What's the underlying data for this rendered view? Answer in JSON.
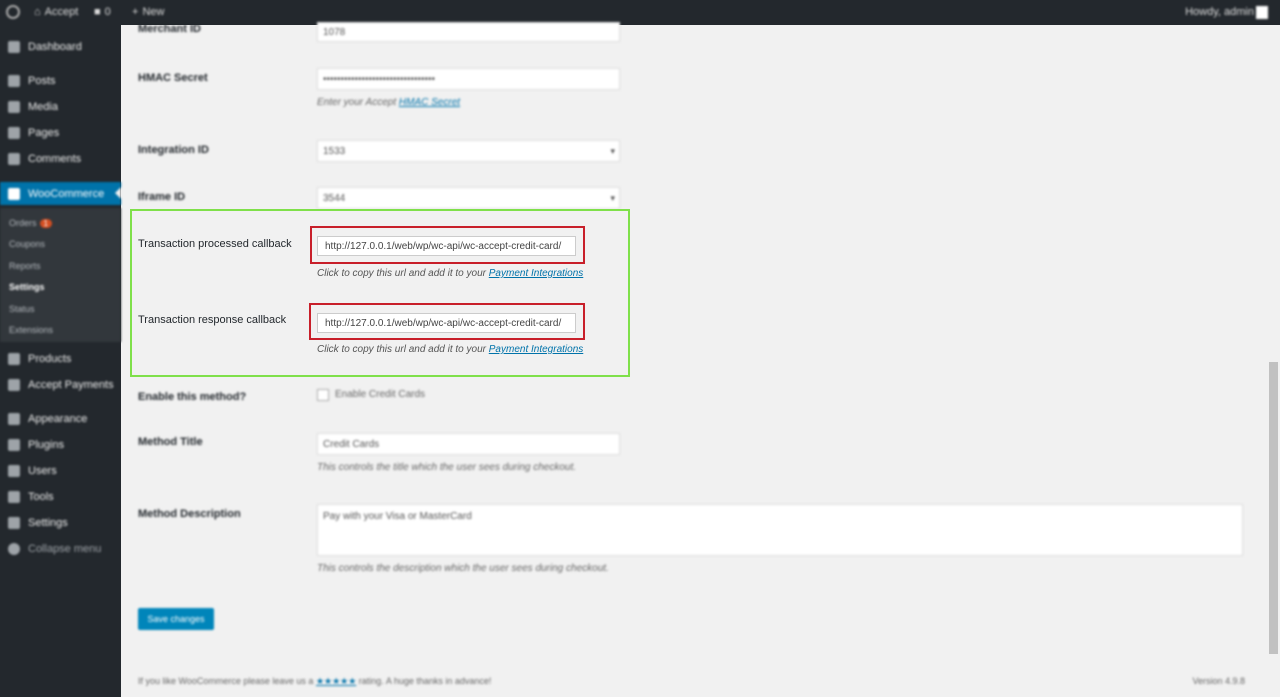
{
  "admin_bar": {
    "site_name": "Accept",
    "comments_count": "0",
    "new_label": "New",
    "howdy": "Howdy, admin"
  },
  "sidebar": {
    "items": [
      {
        "label": "Dashboard",
        "icon": "dashboard-icon"
      },
      {
        "label": "Posts",
        "icon": "pin-icon"
      },
      {
        "label": "Media",
        "icon": "media-icon"
      },
      {
        "label": "Pages",
        "icon": "pages-icon"
      },
      {
        "label": "Comments",
        "icon": "comment-icon"
      },
      {
        "label": "WooCommerce",
        "icon": "woo-icon"
      },
      {
        "label": "Products",
        "icon": "products-icon"
      },
      {
        "label": "Accept Payments",
        "icon": "gear-icon"
      },
      {
        "label": "Appearance",
        "icon": "brush-icon"
      },
      {
        "label": "Plugins",
        "icon": "plug-icon"
      },
      {
        "label": "Users",
        "icon": "user-icon"
      },
      {
        "label": "Tools",
        "icon": "wrench-icon"
      },
      {
        "label": "Settings",
        "icon": "settings-icon"
      },
      {
        "label": "Collapse menu",
        "icon": "collapse-icon"
      }
    ],
    "submenu": {
      "orders": "Orders",
      "orders_badge": "1",
      "coupons": "Coupons",
      "reports": "Reports",
      "settings": "Settings",
      "status": "Status",
      "extensions": "Extensions"
    }
  },
  "form": {
    "merchant_id": {
      "label": "Merchant ID",
      "value": "1078"
    },
    "hmac_secret": {
      "label": "HMAC Secret",
      "value": "••••••••••••••••••••••••••••••••",
      "desc_prefix": "Enter your Accept",
      "desc_link": "HMAC Secret"
    },
    "integration_id": {
      "label": "Integration ID",
      "value": "1533"
    },
    "iframe_id": {
      "label": "Iframe ID",
      "value": "3544"
    },
    "processed_callback": {
      "label": "Transaction processed callback",
      "url": "http://127.0.0.1/web/wp/wc-api/wc-accept-credit-card/",
      "desc_prefix": "Click to copy this url and add it to your",
      "desc_link": "Payment Integrations"
    },
    "response_callback": {
      "label": "Transaction response callback",
      "url": "http://127.0.0.1/web/wp/wc-api/wc-accept-credit-card/",
      "desc_prefix": "Click to copy this url and add it to your",
      "desc_link": "Payment Integrations"
    },
    "enable": {
      "label": "Enable this method?",
      "checkbox_label": "Enable Credit Cards"
    },
    "method_title": {
      "label": "Method Title",
      "value": "Credit Cards",
      "desc": "This controls the title which the user sees during checkout."
    },
    "method_description": {
      "label": "Method Description",
      "value": "Pay with your Visa or MasterCard",
      "desc": "This controls the description which the user sees during checkout."
    },
    "save_label": "Save changes"
  },
  "footer": {
    "left_prefix": "If you like WooCommerce please leave us a",
    "stars": "★★★★★",
    "left_suffix": "rating. A huge thanks in advance!",
    "version": "Version 4.9.8"
  },
  "colors": {
    "highlight_green": "#7fe04a",
    "highlight_red": "#c81f2a",
    "accent": "#0073aa"
  }
}
